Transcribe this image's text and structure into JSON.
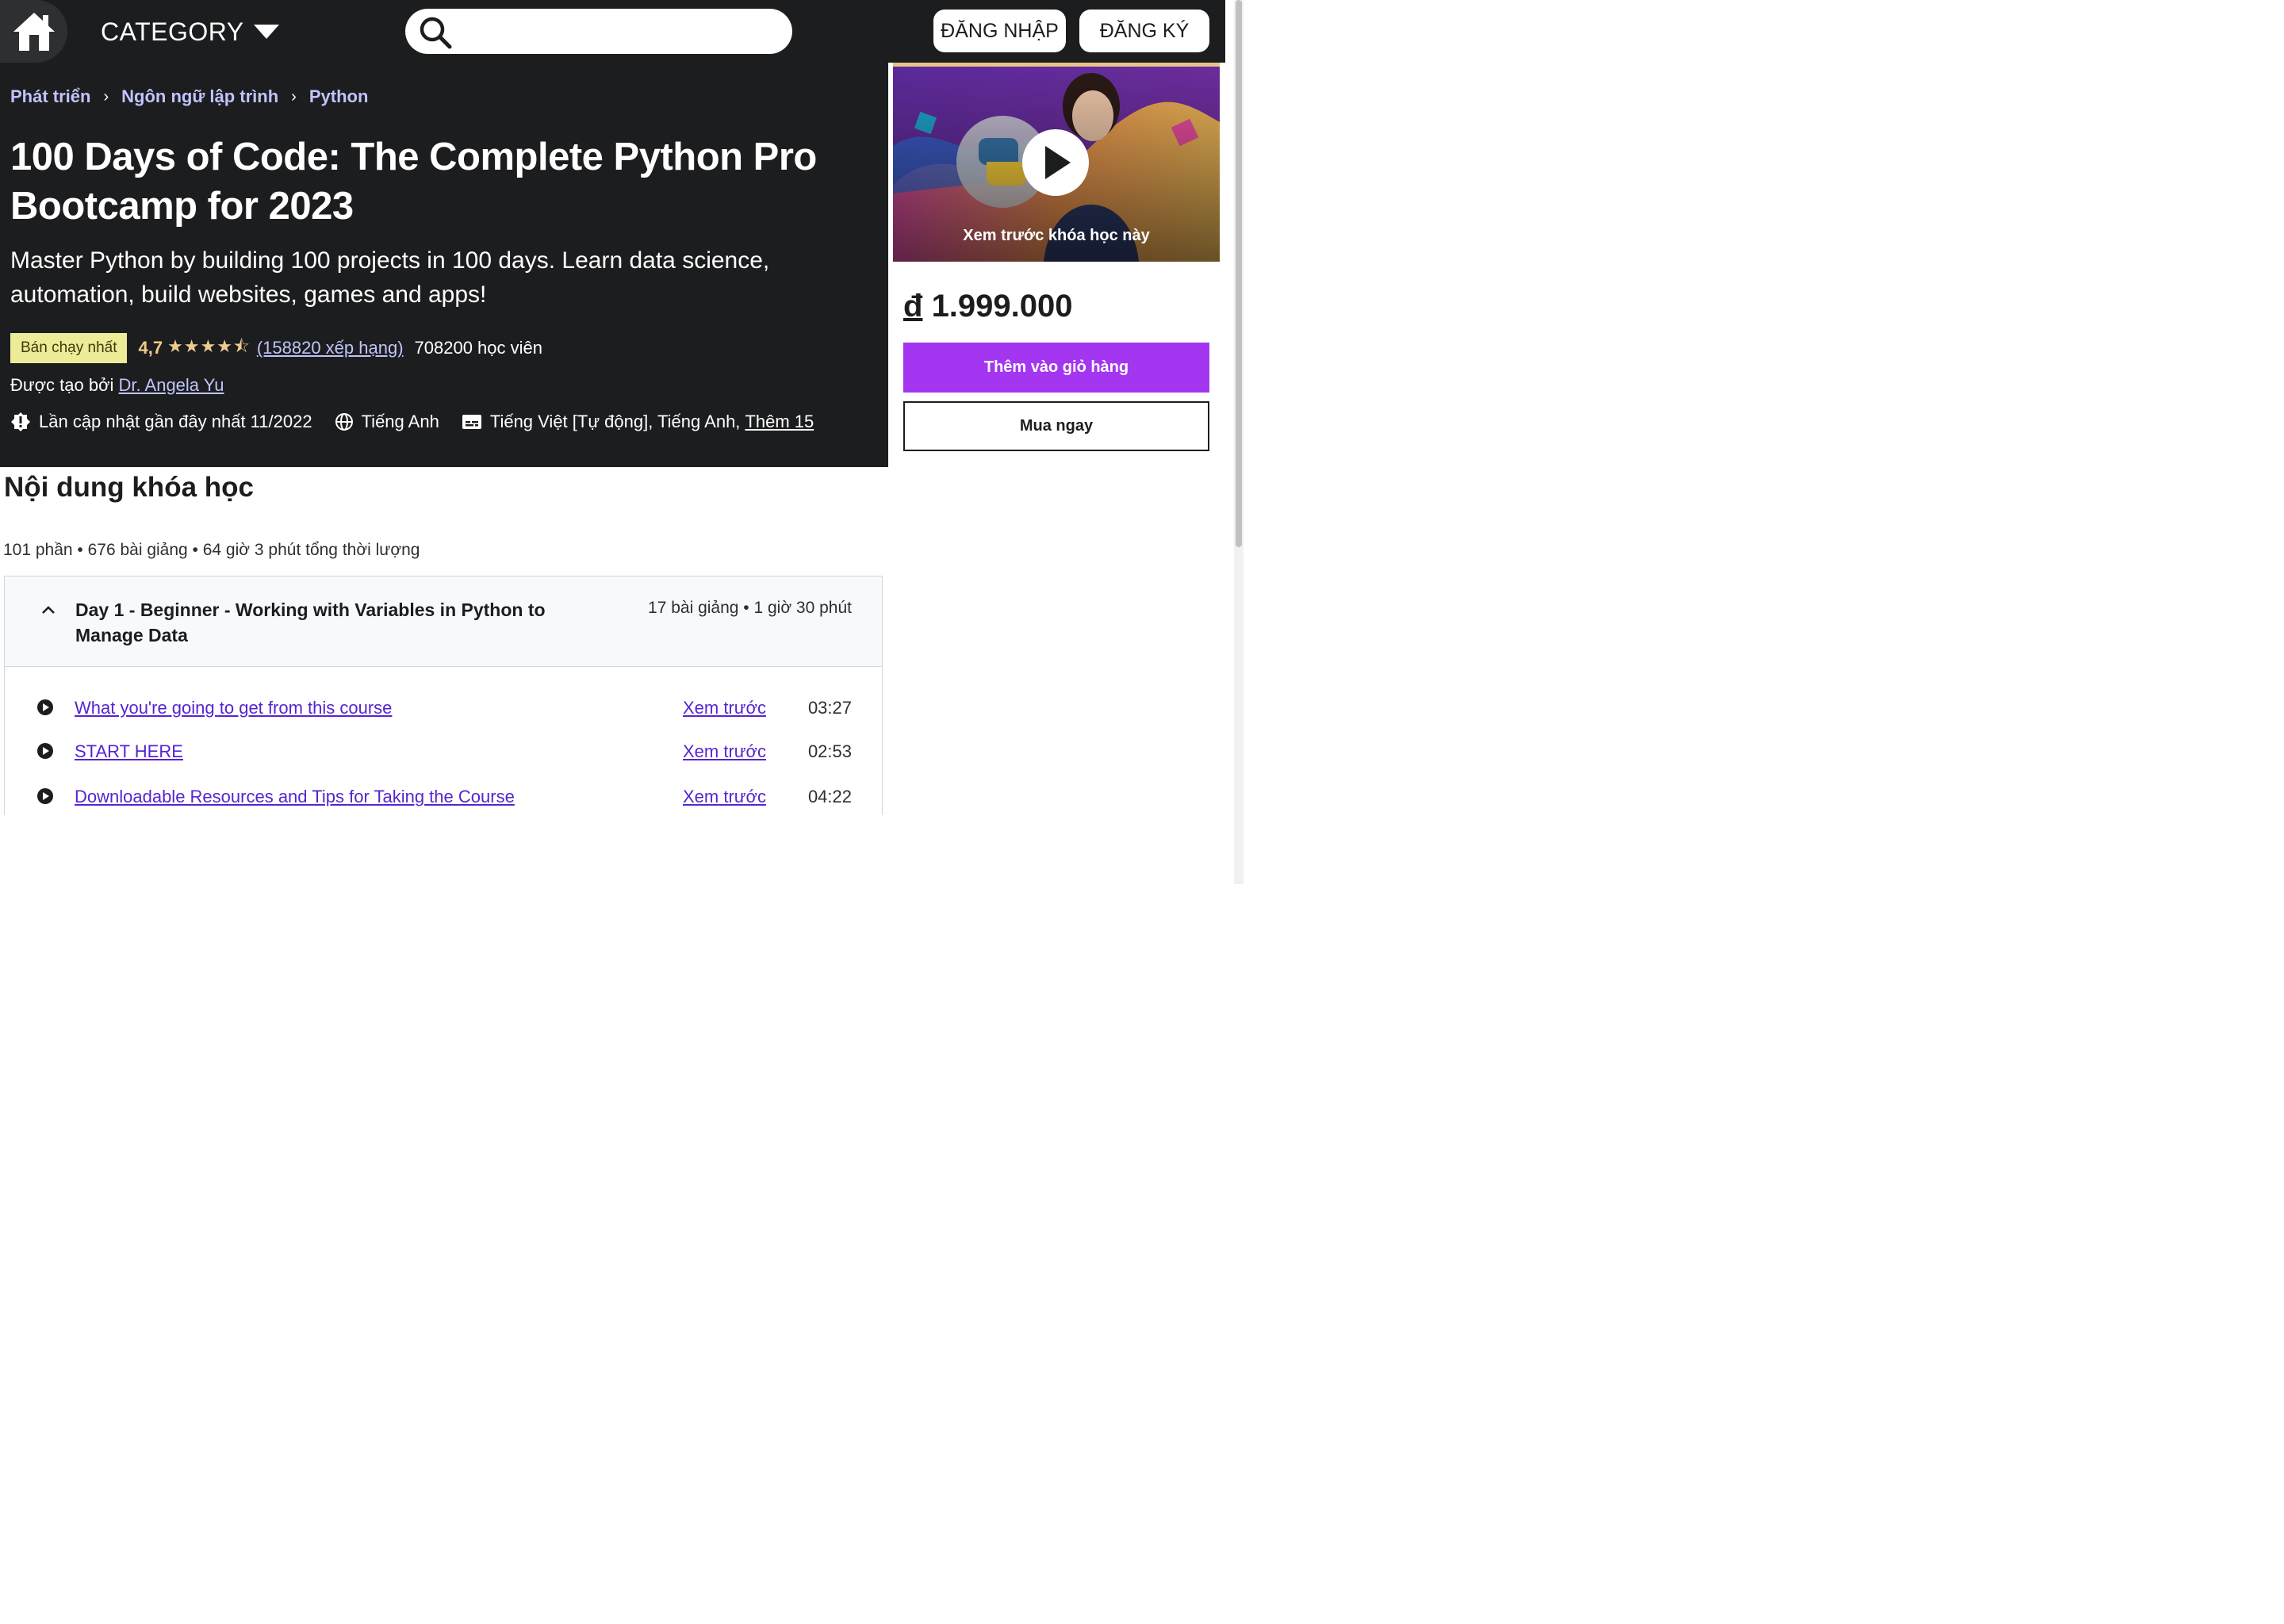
{
  "nav": {
    "category_label": "CATEGORY",
    "search_placeholder": "",
    "login_label": "ĐĂNG NHẬP",
    "signup_label": "ĐĂNG KÝ"
  },
  "breadcrumb": [
    "Phát triển",
    "Ngôn ngữ lập trình",
    "Python"
  ],
  "course": {
    "title": "100 Days of Code: The Complete Python Pro Bootcamp for 2023",
    "subtitle": "Master Python by building 100 projects in 100 days. Learn data science, automation, build websites, games and apps!",
    "badge": "Bán chạy nhất",
    "rating": "4,7",
    "stars": "★★★★⯪",
    "rating_count": "(158820 xếp hạng)",
    "students": "708200 học viên",
    "created_by_label": "Được tạo bởi",
    "instructor": "Dr. Angela Yu",
    "last_updated": "Lần cập nhật gần đây nhất 11/2022",
    "language": "Tiếng Anh",
    "captions": "Tiếng Việt [Tự động], Tiếng Anh,",
    "captions_more": "Thêm 15"
  },
  "sidebar": {
    "preview_label": "Xem trước khóa học này",
    "price_currency": "đ",
    "price_value": "1.999.000",
    "add_to_cart": "Thêm vào giỏ hàng",
    "buy_now": "Mua ngay"
  },
  "content": {
    "heading": "Nội dung khóa học",
    "summary": "101 phần • 676 bài giảng • 64 giờ 3 phút tổng thời lượng",
    "section": {
      "title": "Day 1 - Beginner - Working with Variables in Python to Manage Data",
      "meta": "17 bài giảng • 1 giờ 30 phút",
      "lectures": [
        {
          "title": "What you're going to get from this course",
          "preview": "Xem trước",
          "duration": "03:27"
        },
        {
          "title": "START HERE",
          "preview": "Xem trước",
          "duration": "02:53"
        },
        {
          "title": "Downloadable Resources and Tips for Taking the Course",
          "preview": "Xem trước",
          "duration": "04:22"
        }
      ]
    }
  },
  "colors": {
    "dark_bg": "#1c1d1f",
    "accent_purple": "#a435f0",
    "link_light": "#c0c4fc",
    "link_purple": "#5624d0",
    "star": "#f3ca8c",
    "badge_bg": "#eceb98"
  }
}
